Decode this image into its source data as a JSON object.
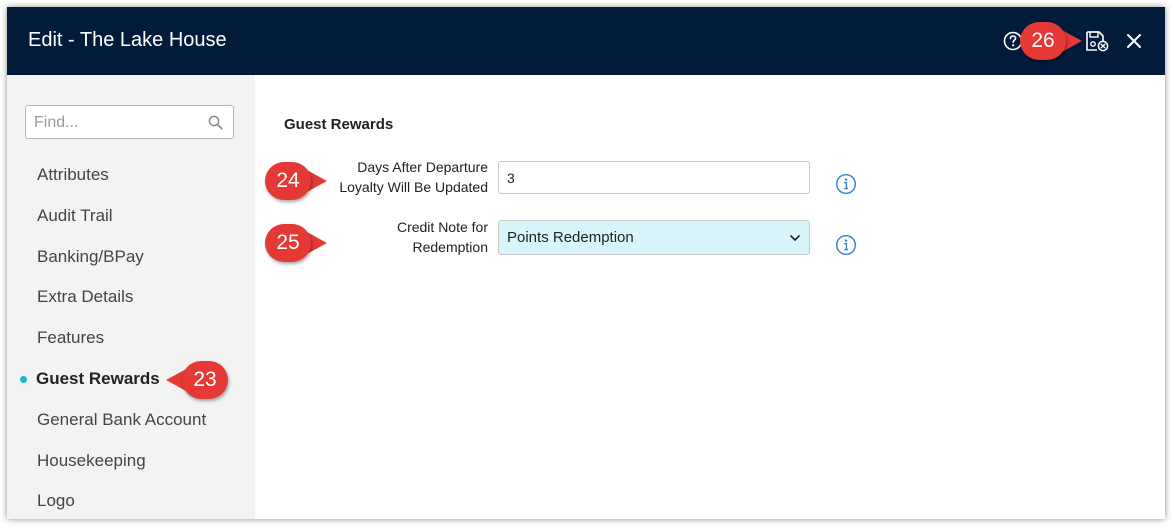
{
  "header": {
    "title": "Edit - The Lake House",
    "background_color": "#021b3a",
    "icons": [
      "help-icon",
      "save-close-icon",
      "close-icon"
    ]
  },
  "sidebar": {
    "search": {
      "placeholder": "Find...",
      "value": ""
    },
    "items": [
      {
        "label": "Attributes"
      },
      {
        "label": "Audit Trail"
      },
      {
        "label": "Banking/BPay"
      },
      {
        "label": "Extra Details"
      },
      {
        "label": "Features"
      },
      {
        "label": "Guest Rewards",
        "active": true
      },
      {
        "label": "General Bank Account"
      },
      {
        "label": "Housekeeping"
      },
      {
        "label": "Logo"
      }
    ],
    "active_dot_color": "#1ab7c8"
  },
  "main": {
    "section_title": "Guest Rewards",
    "fields": [
      {
        "label_line1": "Days After Departure",
        "label_line2": "Loyalty Will Be Updated",
        "value": "3",
        "type": "text"
      },
      {
        "label_line1": "Credit Note for",
        "label_line2": "Redemption",
        "value": "Points Redemption",
        "type": "select",
        "background": "#d7f5fb"
      }
    ]
  },
  "callouts": {
    "color": "#e53935",
    "nav": "23",
    "field1": "24",
    "field2": "25",
    "save": "26"
  }
}
